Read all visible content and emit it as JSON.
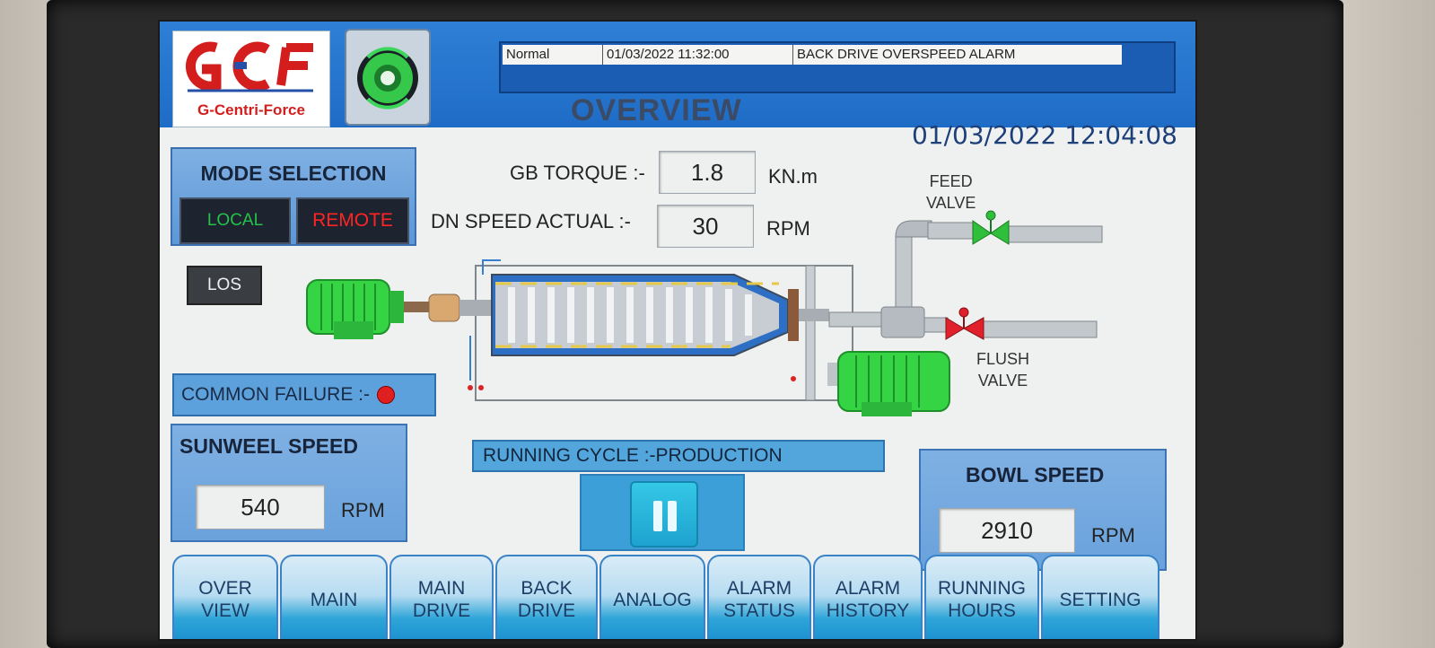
{
  "header": {
    "logo_text": "G-Centri-Force",
    "logo_mark": "GCF",
    "alarm": {
      "state": "Normal",
      "timestamp": "01/03/2022 11:32:00",
      "message": "BACK DRIVE OVERSPEED ALARM"
    },
    "title": "OVERVIEW",
    "clock": "01/03/2022 12:04:08"
  },
  "mode": {
    "title": "MODE SELECTION",
    "local": "LOCAL",
    "remote": "REMOTE"
  },
  "gb_torque": {
    "label": "GB TORQUE  :-",
    "value": "1.8",
    "unit": "KN.m"
  },
  "dn_speed": {
    "label": "DN SPEED ACTUAL :-",
    "value": "30",
    "unit": "RPM"
  },
  "los": "LOS",
  "common_failure": {
    "label": "COMMON FAILURE :-",
    "status_color": "#e02020"
  },
  "sunwheel": {
    "title": "SUNWEEL SPEED",
    "value": "540",
    "unit": "RPM"
  },
  "bowl": {
    "title": "BOWL SPEED",
    "value": "2910",
    "unit": "RPM"
  },
  "running_cycle": "RUNNING CYCLE :-PRODUCTION",
  "valves": {
    "feed": "FEED\nVALVE",
    "flush": "FLUSH\nVALVE",
    "feed_color": "#2fbf3a",
    "flush_color": "#e0212b"
  },
  "tabs": [
    {
      "label": "OVER\nVIEW"
    },
    {
      "label": "MAIN"
    },
    {
      "label": "MAIN\nDRIVE"
    },
    {
      "label": "BACK\nDRIVE"
    },
    {
      "label": "ANALOG"
    },
    {
      "label": "ALARM\nSTATUS"
    },
    {
      "label": "ALARM\nHISTORY"
    },
    {
      "label": "RUNNING\nHOURS"
    },
    {
      "label": "SETTING"
    }
  ],
  "colors": {
    "header_blue": "#1e6cc6",
    "motor_green": "#35d445",
    "panel_blue": "#6aa2dc"
  }
}
